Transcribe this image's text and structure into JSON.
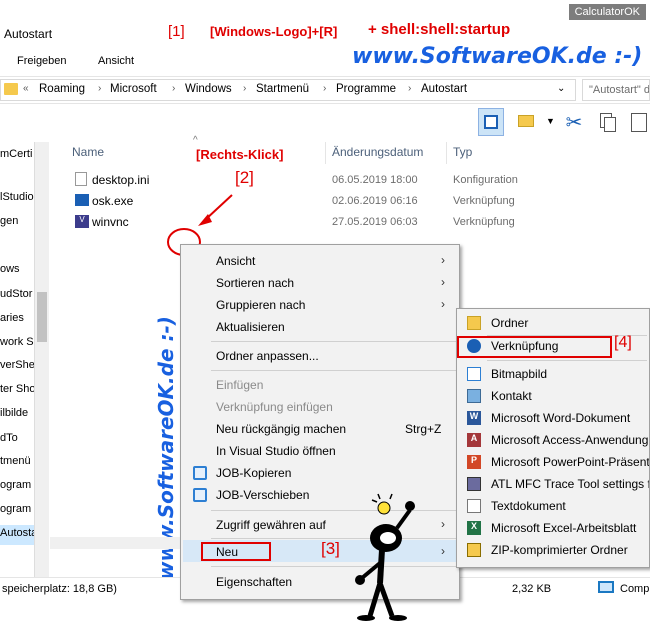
{
  "window": {
    "corner_title": "CalculatorOK",
    "title": "Autostart"
  },
  "ribbon": {
    "tabs": [
      "Freigeben",
      "Ansicht"
    ]
  },
  "annotations": {
    "step1": "[1]",
    "hint": "[Windows-Logo]+[R]",
    "command": "+ shell:shell:startup",
    "site": "www.SoftwareOK.de :-)",
    "vertical": "www.SoftwareOK.de :-)",
    "rightclick": "[Rechts-Klick]",
    "step2": "[2]",
    "step3": "[3]",
    "step4": "[4]"
  },
  "address": {
    "prefix": "«",
    "crumbs": [
      "Roaming",
      "Microsoft",
      "Windows",
      "Startmenü",
      "Programme",
      "Autostart"
    ],
    "search_placeholder": "\"Autostart\" durchsuchen"
  },
  "columns": {
    "name": "Name",
    "date": "Änderungsdatum",
    "type": "Typ"
  },
  "files": [
    {
      "name": "desktop.ini",
      "date": "06.05.2019 18:00",
      "type": "Konfiguration"
    },
    {
      "name": "osk.exe",
      "date": "02.06.2019 06:16",
      "type": "Verknüpfung"
    },
    {
      "name": "winvnc",
      "date": "27.05.2019 06:03",
      "type": "Verknüpfung"
    }
  ],
  "nav_items": [
    "mCerti",
    "lStudio",
    "gen",
    "ows",
    "udStor",
    "aries",
    "work S",
    "verShel",
    "ter Sho",
    "ilbilde",
    "dTo",
    "tmenü",
    "ogram",
    "ogram",
    "Autostart"
  ],
  "context_menu": {
    "items": [
      {
        "label": "Ansicht",
        "arrow": true
      },
      {
        "label": "Sortieren nach",
        "arrow": true
      },
      {
        "label": "Gruppieren nach",
        "arrow": true
      },
      {
        "label": "Aktualisieren"
      },
      {
        "label": "Ordner anpassen..."
      },
      {
        "label": "Einfügen",
        "disabled": true
      },
      {
        "label": "Verknüpfung einfügen",
        "disabled": true
      },
      {
        "label": "Neu rückgängig machen",
        "shortcut": "Strg+Z"
      },
      {
        "label": "In Visual Studio öffnen"
      },
      {
        "label": "JOB-Kopieren"
      },
      {
        "label": "JOB-Verschieben"
      },
      {
        "label": "Zugriff gewähren auf",
        "arrow": true
      },
      {
        "label": "Neu",
        "arrow": true
      },
      {
        "label": "Eigenschaften"
      }
    ]
  },
  "submenu": {
    "items": [
      "Ordner",
      "Verknüpfung",
      "Bitmapbild",
      "Kontakt",
      "Microsoft Word-Dokument",
      "Microsoft Access-Anwendung",
      "Microsoft PowerPoint-Präsentation",
      "ATL MFC Trace Tool settings file",
      "Textdokument",
      "Microsoft Excel-Arbeitsblatt",
      "ZIP-komprimierter Ordner"
    ]
  },
  "status": {
    "left": "speicherplatz: 18,8 GB)",
    "size": "2,32 KB",
    "computer": "Computer"
  },
  "colors": {
    "red": "#e00000",
    "blue": "#1860e0",
    "folder": "#f5c94d"
  }
}
